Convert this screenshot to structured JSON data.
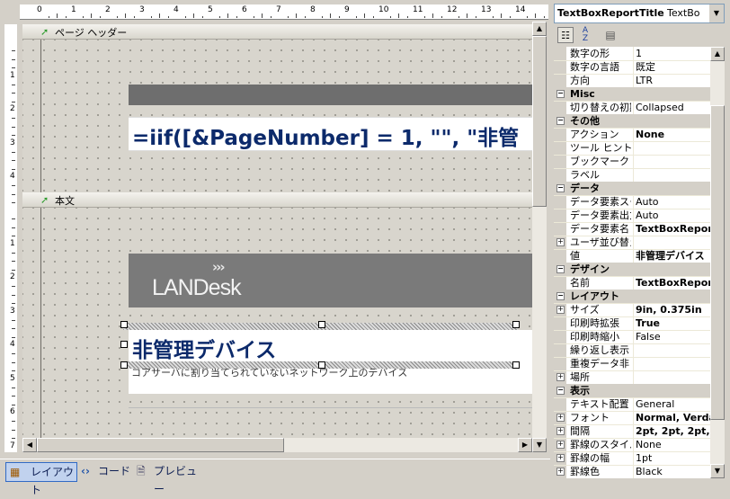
{
  "designer": {
    "ruler_numbers": [
      "0",
      "1",
      "2",
      "3",
      "4",
      "5",
      "6",
      "7",
      "8",
      "9",
      "10",
      "11",
      "12",
      "13",
      "14"
    ],
    "vruler_header": [
      "1",
      "2",
      "3",
      "4"
    ],
    "vruler_body": [
      "1",
      "2",
      "3",
      "4",
      "5",
      "6",
      "7"
    ],
    "page_header_label": "ページ ヘッダー",
    "body_label": "本文",
    "expression_text": "=iif([&PageNumber] = 1, \"\", \"非管",
    "logo_text": "LANDesk",
    "title_text": "非管理デバイス",
    "subtitle_text": "コアサーバに割り当てられていないネットワーク上のデバイス"
  },
  "tabs": {
    "layout": "レイアウト",
    "code": "コード",
    "preview": "プレビュー"
  },
  "properties": {
    "object_name": "TextBoxReportTitle",
    "object_type": "TextBo",
    "rows": [
      {
        "kind": "prop",
        "key": "数字の形",
        "value": "1",
        "bold": false,
        "expand": false
      },
      {
        "kind": "prop",
        "key": "数字の言語",
        "value": "既定",
        "bold": false,
        "expand": false
      },
      {
        "kind": "prop",
        "key": "方向",
        "value": "LTR",
        "bold": false,
        "expand": false
      },
      {
        "kind": "cat",
        "key": "Misc"
      },
      {
        "kind": "prop",
        "key": "切り替えの初期",
        "value": "Collapsed",
        "bold": false,
        "expand": false
      },
      {
        "kind": "cat",
        "key": "その他"
      },
      {
        "kind": "prop",
        "key": "アクション",
        "value": "None",
        "bold": true,
        "expand": false
      },
      {
        "kind": "prop",
        "key": "ツール ヒント",
        "value": "",
        "bold": false,
        "expand": false
      },
      {
        "kind": "prop",
        "key": "ブックマーク",
        "value": "",
        "bold": false,
        "expand": false
      },
      {
        "kind": "prop",
        "key": "ラベル",
        "value": "",
        "bold": false,
        "expand": false
      },
      {
        "kind": "cat",
        "key": "データ"
      },
      {
        "kind": "prop",
        "key": "データ要素スタ",
        "value": "Auto",
        "bold": false,
        "expand": false
      },
      {
        "kind": "prop",
        "key": "データ要素出力",
        "value": "Auto",
        "bold": false,
        "expand": false
      },
      {
        "kind": "prop",
        "key": "データ要素名",
        "value": "TextBoxReport",
        "bold": true,
        "expand": false
      },
      {
        "kind": "prop",
        "key": "ユーザ並び替え",
        "value": "",
        "bold": false,
        "expand": true
      },
      {
        "kind": "prop",
        "key": "値",
        "value": "非管理デバイス",
        "bold": true,
        "expand": false
      },
      {
        "kind": "cat",
        "key": "デザイン"
      },
      {
        "kind": "prop",
        "key": "名前",
        "value": "TextBoxRepor",
        "bold": true,
        "expand": false
      },
      {
        "kind": "cat",
        "key": "レイアウト"
      },
      {
        "kind": "prop",
        "key": "サイズ",
        "value": "9in, 0.375in",
        "bold": true,
        "expand": true
      },
      {
        "kind": "prop",
        "key": "印刷時拡張",
        "value": "True",
        "bold": true,
        "expand": false
      },
      {
        "kind": "prop",
        "key": "印刷時縮小",
        "value": "False",
        "bold": false,
        "expand": false
      },
      {
        "kind": "prop",
        "key": "繰り返し表示",
        "value": "",
        "bold": false,
        "expand": false
      },
      {
        "kind": "prop",
        "key": "重複データ非",
        "value": "",
        "bold": false,
        "expand": false
      },
      {
        "kind": "prop",
        "key": "場所",
        "value": "",
        "bold": false,
        "expand": true
      },
      {
        "kind": "cat",
        "key": "表示"
      },
      {
        "kind": "prop",
        "key": "テキスト配置",
        "value": "General",
        "bold": false,
        "expand": false
      },
      {
        "kind": "prop",
        "key": "フォント",
        "value": "Normal, Verda",
        "bold": true,
        "expand": true
      },
      {
        "kind": "prop",
        "key": "間隔",
        "value": "2pt, 2pt, 2pt, 2",
        "bold": true,
        "expand": true
      },
      {
        "kind": "prop",
        "key": "罫線のスタイル",
        "value": "None",
        "bold": false,
        "expand": true
      },
      {
        "kind": "prop",
        "key": "罫線の幅",
        "value": "1pt",
        "bold": false,
        "expand": true
      },
      {
        "kind": "prop",
        "key": "罫線色",
        "value": "Black",
        "bold": false,
        "expand": true
      }
    ]
  },
  "colors": {
    "band_bar": "#6e6e6e",
    "logo_bar": "#7a7a7a",
    "title_text": "#0c2a6b",
    "selected_tab": "#c1d2ee"
  }
}
